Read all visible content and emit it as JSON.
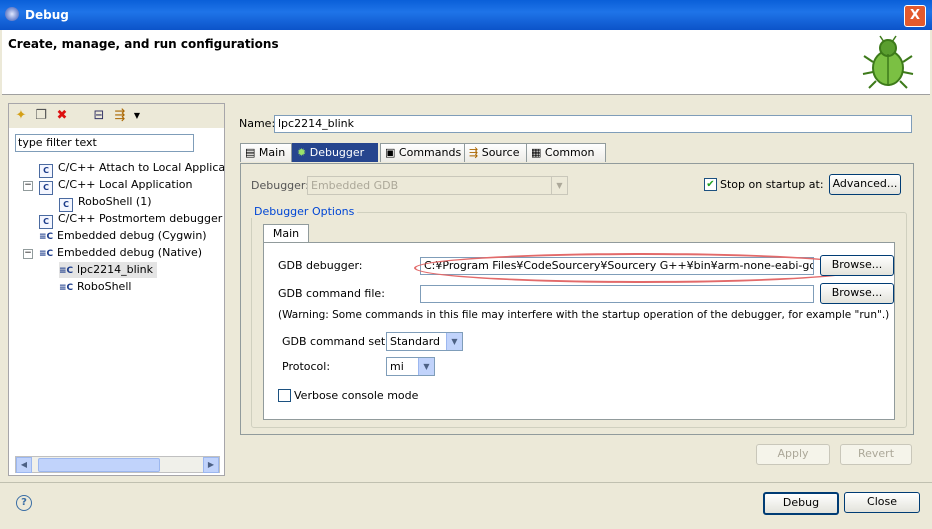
{
  "window": {
    "title": "Debug",
    "close_label": "X"
  },
  "banner": {
    "title": "Create, manage, and run configurations"
  },
  "left": {
    "filter_text": "type filter text",
    "tree": [
      {
        "label": "C/C++ Attach to Local Applicat"
      },
      {
        "label": "C/C++ Local Application"
      },
      {
        "label": "RoboShell (1)"
      },
      {
        "label": "C/C++ Postmortem debugger"
      },
      {
        "label": "Embedded debug (Cygwin)"
      },
      {
        "label": "Embedded debug (Native)"
      },
      {
        "label": "lpc2214_blink"
      },
      {
        "label": "RoboShell"
      }
    ]
  },
  "config": {
    "name_label": "Name:",
    "name_value": "lpc2214_blink",
    "tabs": [
      "Main",
      "Debugger",
      "Commands",
      "Source",
      "Common"
    ],
    "debugger_label": "Debugger:",
    "debugger_value": "Embedded GDB",
    "stop_on_startup_label": "Stop on startup at:",
    "advanced_label": "Advanced...",
    "group_title": "Debugger Options",
    "subtab_main": "Main",
    "gdb_debugger_label": "GDB debugger:",
    "gdb_debugger_value": "C:¥Program Files¥CodeSourcery¥Sourcery G++¥bin¥arm-none-eabi-gdb.exe",
    "browse_label": "Browse...",
    "gdb_command_file_label": "GDB command file:",
    "gdb_command_file_value": "",
    "warning_text": "(Warning: Some commands in this file may interfere with the startup operation of the debugger, for example \"run\".)",
    "command_set_label": "GDB command set:",
    "command_set_value": "Standard",
    "protocol_label": "Protocol:",
    "protocol_value": "mi",
    "verbose_label": "Verbose console mode",
    "apply_label": "Apply",
    "revert_label": "Revert"
  },
  "footer": {
    "help_label": "?",
    "debug_label": "Debug",
    "close_label": "Close"
  }
}
